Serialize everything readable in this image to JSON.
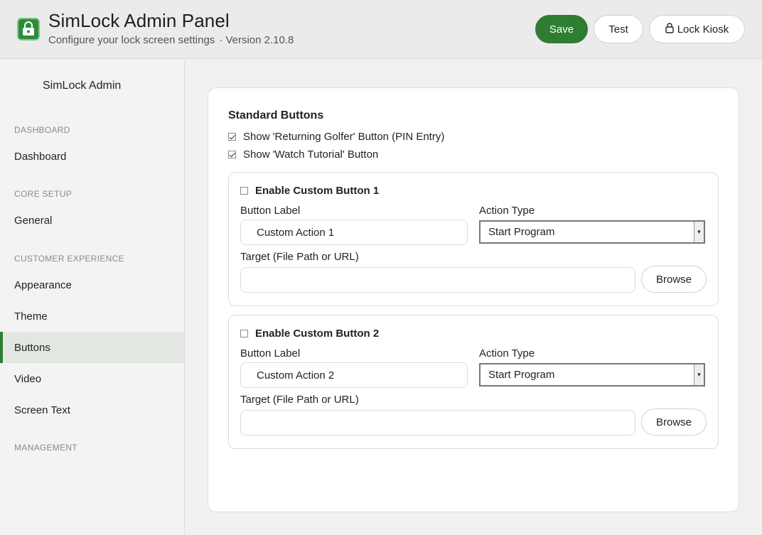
{
  "header": {
    "title": "SimLock Admin Panel",
    "subtitle": "Configure your lock screen settings",
    "version": "· Version 2.10.8",
    "logo_icon": "lock-screen-logo-icon",
    "save_label": "Save",
    "test_label": "Test",
    "lock_label": "Lock Kiosk",
    "lock_icon": "lock-icon"
  },
  "colors": {
    "accent": "#2e7d32",
    "active_nav_bg": "#e2e8e1"
  },
  "sidebar": {
    "title": "SimLock Admin",
    "sections": {
      "dashboard": "DASHBOARD",
      "core_setup": "CORE SETUP",
      "customer_experience": "CUSTOMER EXPERIENCE",
      "management": "MANAGEMENT"
    },
    "items": {
      "dashboard": "Dashboard",
      "general": "General",
      "appearance": "Appearance",
      "theme": "Theme",
      "buttons": "Buttons",
      "video": "Video",
      "screen_text": "Screen Text"
    },
    "active_item": "Buttons"
  },
  "main": {
    "section_title": "Standard Buttons",
    "standard": [
      {
        "label": "Show 'Returning Golfer' Button (PIN Entry)",
        "checked": true
      },
      {
        "label": "Show 'Watch Tutorial' Button",
        "checked": true
      }
    ],
    "custom": [
      {
        "enable_label": "Enable Custom Button 1",
        "enabled": false,
        "button_label_title": "Button Label",
        "button_label_value": "Custom Action 1",
        "action_type_title": "Action Type",
        "action_type_value": "Start Program",
        "target_title": "Target (File Path or URL)",
        "target_value": "",
        "browse_label": "Browse"
      },
      {
        "enable_label": "Enable Custom Button 2",
        "enabled": false,
        "button_label_title": "Button Label",
        "button_label_value": "Custom Action 2",
        "action_type_title": "Action Type",
        "action_type_value": "Start Program",
        "target_title": "Target (File Path or URL)",
        "target_value": "",
        "browse_label": "Browse"
      }
    ]
  }
}
